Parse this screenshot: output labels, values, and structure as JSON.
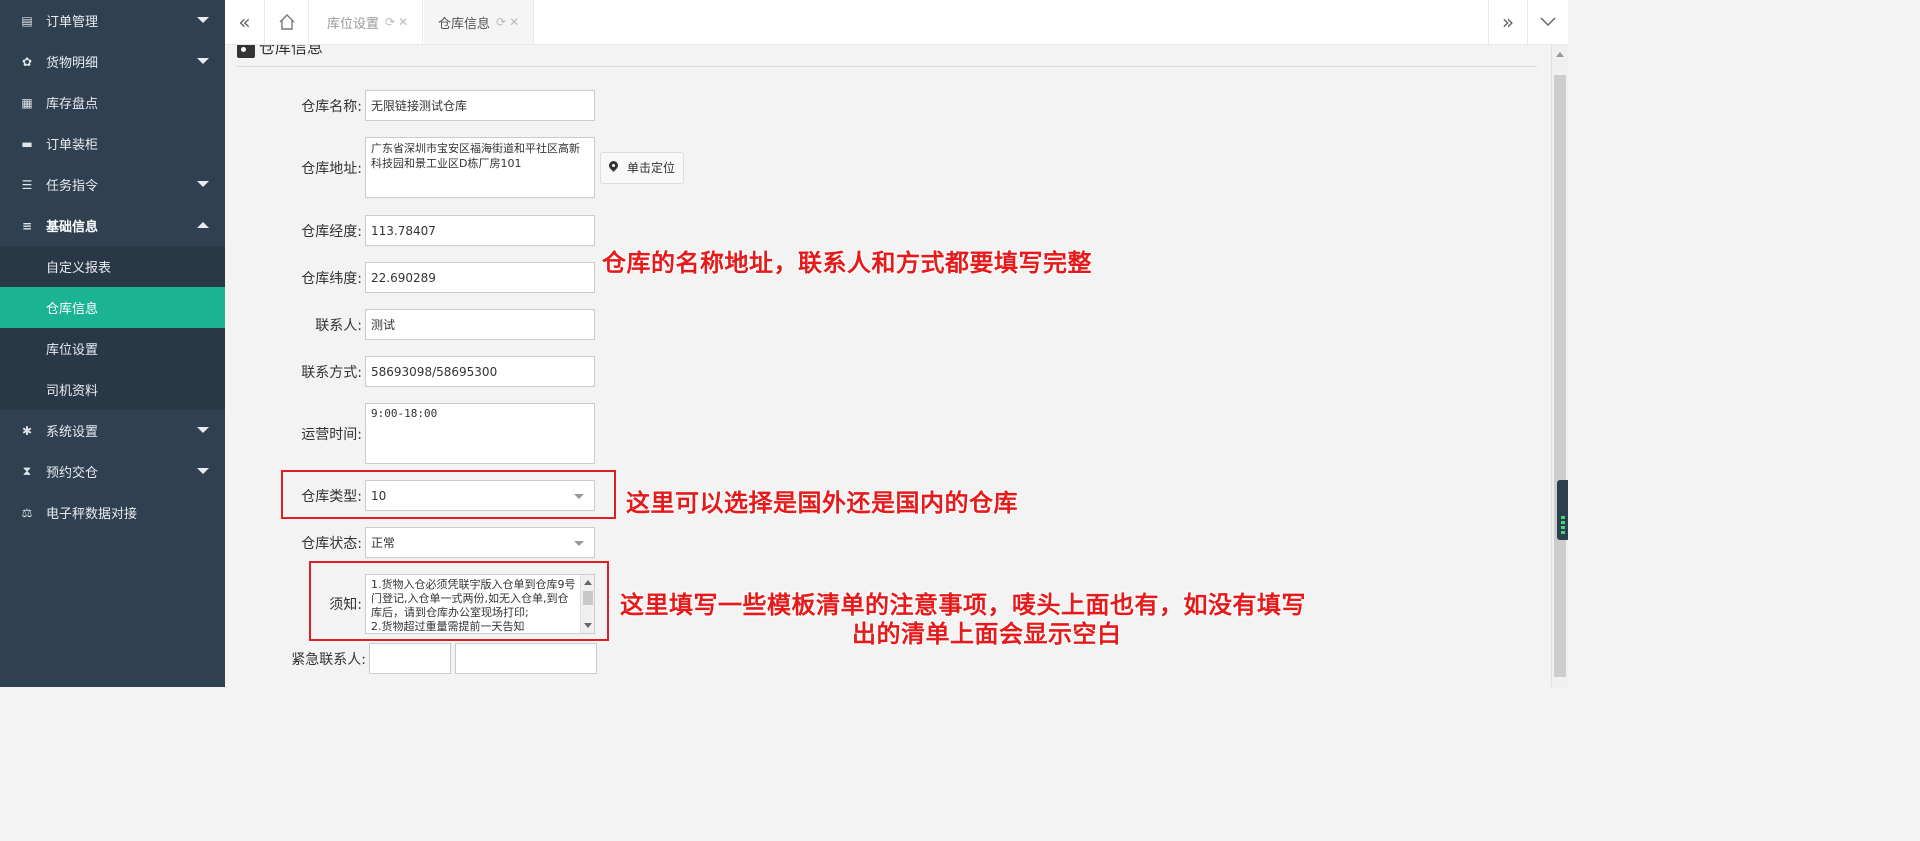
{
  "sidebar": {
    "items": [
      {
        "label": "订单管理",
        "icon": "receipt-icon",
        "caret": "down"
      },
      {
        "label": "货物明细",
        "icon": "cubes-icon",
        "caret": "down"
      },
      {
        "label": "库存盘点",
        "icon": "table-icon",
        "caret": ""
      },
      {
        "label": "订单装柜",
        "icon": "truck-icon",
        "caret": ""
      },
      {
        "label": "任务指令",
        "icon": "list-icon",
        "caret": "down"
      },
      {
        "label": "基础信息",
        "icon": "bars-icon",
        "caret": "up"
      },
      {
        "label": "系统设置",
        "icon": "gear-icon",
        "caret": "down"
      },
      {
        "label": "预约交仓",
        "icon": "hourglass-icon",
        "caret": "down"
      },
      {
        "label": "电子秤数据对接",
        "icon": "scale-icon",
        "caret": ""
      }
    ],
    "subitems": [
      "自定义报表",
      "仓库信息",
      "库位设置",
      "司机资料"
    ],
    "active_sub": "仓库信息"
  },
  "tabs": [
    {
      "label": "库位设置",
      "active": false
    },
    {
      "label": "仓库信息",
      "active": true
    }
  ],
  "section": {
    "title": "仓库信息"
  },
  "form": {
    "name_label": "仓库名称:",
    "name_value": "无限链接测试仓库",
    "address_label": "仓库地址:",
    "address_value": "广东省深圳市宝安区福海街道和平社区高新科技园和景工业区D栋厂房101",
    "locate_button": "单击定位",
    "lng_label": "仓库经度:",
    "lng_value": "113.78407",
    "lat_label": "仓库纬度:",
    "lat_value": "22.690289",
    "contact_label": "联系人:",
    "contact_value": "测试",
    "phone_label": "联系方式:",
    "phone_value": "58693098/58695300",
    "hours_label": "运营时间:",
    "hours_value": "9:00-18:00",
    "type_label": "仓库类型:",
    "type_value": "10",
    "status_label": "仓库状态:",
    "status_value": "正常",
    "notice_label": "须知:",
    "notice_value": "1.货物入仓必须凭联宇版入仓单到仓库9号门登记,入仓单一式两份,如无入仓单,到仓库后，请到仓库办公室现场打印;\n2.货物超过重量需提前一天告知",
    "urgent_label": "紧急联系人:"
  },
  "annotations": {
    "a1": "仓库的名称地址，联系人和方式都要填写完整",
    "a2": "这里可以选择是国外还是国内的仓库",
    "a3_line1": "这里填写一些模板清单的注意事项，唛头上面也有，如没有填写",
    "a3_line2": "出的清单上面会显示空白"
  },
  "colors": {
    "sidebar": "#2f4050",
    "active": "#1ab394",
    "annotation": "#e61a1a"
  }
}
